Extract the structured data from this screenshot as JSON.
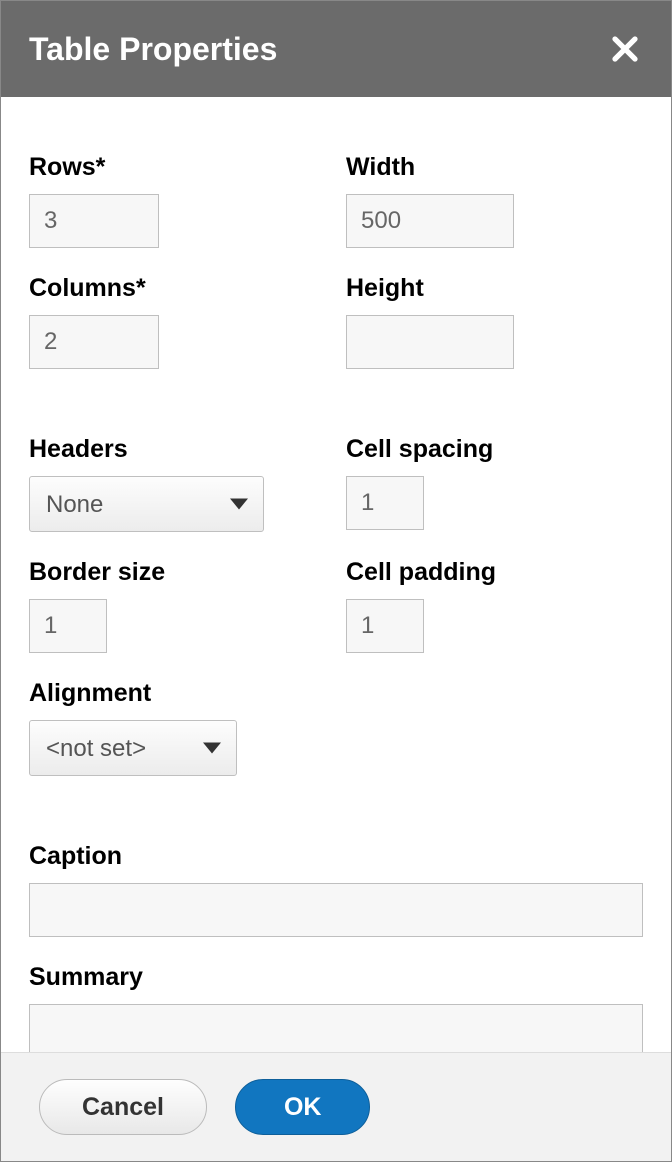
{
  "dialog": {
    "title": "Table Properties"
  },
  "fields": {
    "rows": {
      "label": "Rows*",
      "value": "3"
    },
    "columns": {
      "label": "Columns*",
      "value": "2"
    },
    "width": {
      "label": "Width",
      "value": "500"
    },
    "height": {
      "label": "Height",
      "value": ""
    },
    "headers": {
      "label": "Headers",
      "value": "None"
    },
    "borderSize": {
      "label": "Border size",
      "value": "1"
    },
    "alignment": {
      "label": "Alignment",
      "value": "<not set>"
    },
    "cellSpacing": {
      "label": "Cell spacing",
      "value": "1"
    },
    "cellPadding": {
      "label": "Cell padding",
      "value": "1"
    },
    "caption": {
      "label": "Caption",
      "value": ""
    },
    "summary": {
      "label": "Summary",
      "value": ""
    }
  },
  "buttons": {
    "cancel": "Cancel",
    "ok": "OK"
  }
}
